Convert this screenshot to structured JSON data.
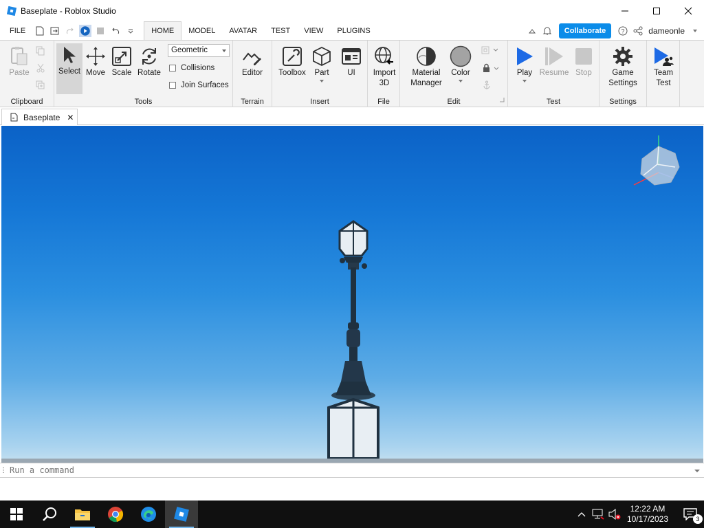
{
  "window": {
    "title": "Baseplate - Roblox Studio",
    "app_icon": "roblox-studio-icon",
    "accent": "#0b8ce9"
  },
  "menu": {
    "file_label": "FILE",
    "tabs": [
      {
        "label": "HOME",
        "active": true
      },
      {
        "label": "MODEL",
        "active": false
      },
      {
        "label": "AVATAR",
        "active": false
      },
      {
        "label": "TEST",
        "active": false
      },
      {
        "label": "VIEW",
        "active": false
      },
      {
        "label": "PLUGINS",
        "active": false
      }
    ],
    "collaborate_label": "Collaborate",
    "username": "dameonle"
  },
  "ribbon": {
    "clipboard": {
      "label": "Clipboard",
      "paste_label": "Paste"
    },
    "tools": {
      "label": "Tools",
      "select_label": "Select",
      "move_label": "Move",
      "scale_label": "Scale",
      "rotate_label": "Rotate",
      "mode_value": "Geometric",
      "collisions_label": "Collisions",
      "join_surfaces_label": "Join Surfaces"
    },
    "terrain": {
      "label": "Terrain",
      "editor_label": "Editor"
    },
    "insert": {
      "label": "Insert",
      "toolbox_label": "Toolbox",
      "part_label": "Part",
      "ui_label": "UI"
    },
    "file": {
      "label": "File",
      "import_label_1": "Import",
      "import_label_2": "3D"
    },
    "edit": {
      "label": "Edit",
      "material_label_1": "Material",
      "material_label_2": "Manager",
      "color_label": "Color"
    },
    "test": {
      "label": "Test",
      "play_label": "Play",
      "resume_label": "Resume",
      "stop_label": "Stop"
    },
    "settings": {
      "label": "Settings",
      "game_label_1": "Game",
      "game_label_2": "Settings"
    },
    "team": {
      "label_1": "Team",
      "label_2": "Test"
    }
  },
  "document": {
    "tab_label": "Baseplate",
    "close_symbol": "✕"
  },
  "command": {
    "placeholder": "Run a command"
  },
  "taskbar": {
    "time": "12:22 AM",
    "date": "10/17/2023",
    "notifications": "3"
  }
}
